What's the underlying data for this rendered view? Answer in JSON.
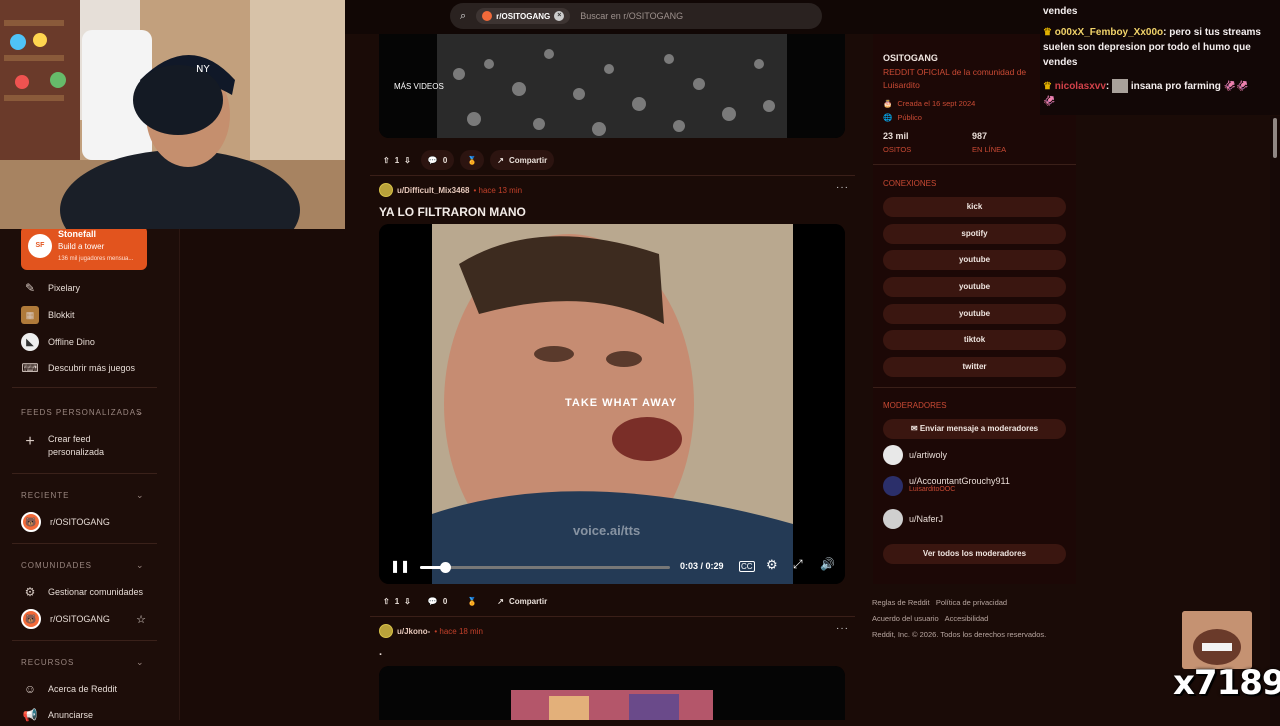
{
  "search": {
    "community_chip": "r/OSITOGANG",
    "placeholder": "Buscar en r/OSITOGANG"
  },
  "sidebar": {
    "game_card": {
      "title": "Stonefall",
      "subtitle": "Build a tower",
      "meta": "136 mil jugadores mensua..."
    },
    "games": [
      {
        "label": "Pixelary",
        "icon": "pencil-icon"
      },
      {
        "label": "Blokkit",
        "icon": "grid-block-icon"
      },
      {
        "label": "Offline Dino",
        "icon": "dino-icon"
      },
      {
        "label": "Descubrir más juegos",
        "icon": "gamepad-icon"
      }
    ],
    "feeds_header": "FEEDS PERSONALIZADAS",
    "create_feed": "Crear feed personalizada",
    "recent_header": "RECIENTE",
    "recent_item": "r/OSITOGANG",
    "communities_header": "COMUNIDADES",
    "manage_communities": "Gestionar comunidades",
    "community_item": "r/OSITOGANG",
    "resources_header": "RECURSOS",
    "about": "Acerca de Reddit",
    "ads": "Anunciarse"
  },
  "feed": {
    "post1": {
      "overlay_text": "MÁS VIDEOS",
      "votes": "1",
      "comments": "0",
      "share": "Compartir"
    },
    "post2": {
      "user": "u/Difficult_Mix3468",
      "time": "• hace 13 min",
      "title": "YA LO FILTRARON MANO",
      "caption": "TAKE WHAT AWAY",
      "watermark": "voice.ai/tts",
      "time_display": "0:03 / 0:29",
      "progress": 0.1,
      "votes": "1",
      "comments": "0",
      "share": "Compartir"
    },
    "post3": {
      "user": "u/Jkono-",
      "time": "• hace 18 min",
      "title": "."
    }
  },
  "community": {
    "name": "OSITOGANG",
    "description": "REDDIT OFICIAL de la comunidad de Luisardito",
    "created": "Creada el 16 sept 2024",
    "visibility": "Público",
    "members": "23 mil",
    "members_label": "OSITOS",
    "online": "987",
    "online_label": "EN LÍNEA",
    "connections_header": "CONEXIONES",
    "connections": [
      "kick",
      "spotify",
      "youtube",
      "youtube",
      "youtube",
      "tiktok",
      "twitter"
    ],
    "moderators_header": "MODERADORES",
    "message_mods": "Enviar mensaje a moderadores",
    "moderators": [
      {
        "name": "u/artiwoly",
        "flair": ""
      },
      {
        "name": "u/AccountantGrouchy911",
        "flair": "LuisarditoOOC"
      },
      {
        "name": "u/NaferJ",
        "flair": ""
      }
    ],
    "view_all": "Ver todos los moderadores"
  },
  "footer": {
    "rules": "Reglas de Reddit",
    "privacy": "Política de privacidad",
    "agreement": "Acuerdo del usuario",
    "accessibility": "Accesibilidad",
    "copyright": "Reddit, Inc. © 2026. Todos los derechos reservados."
  },
  "chat": {
    "line0": "vendes",
    "msg1_user": "o00xX_Femboy_Xx00o",
    "msg1_text": ": pero si tus streams suelen son depresion por todo el humo que vendes",
    "msg2_user": "nicolasxvv",
    "msg2_sep": ":",
    "msg2_text": "insana pro farming"
  },
  "overlay": {
    "counter": "x7189"
  },
  "colors": {
    "accent": "#e2541e",
    "link": "#c94a34",
    "bg": "#1a0b07"
  }
}
